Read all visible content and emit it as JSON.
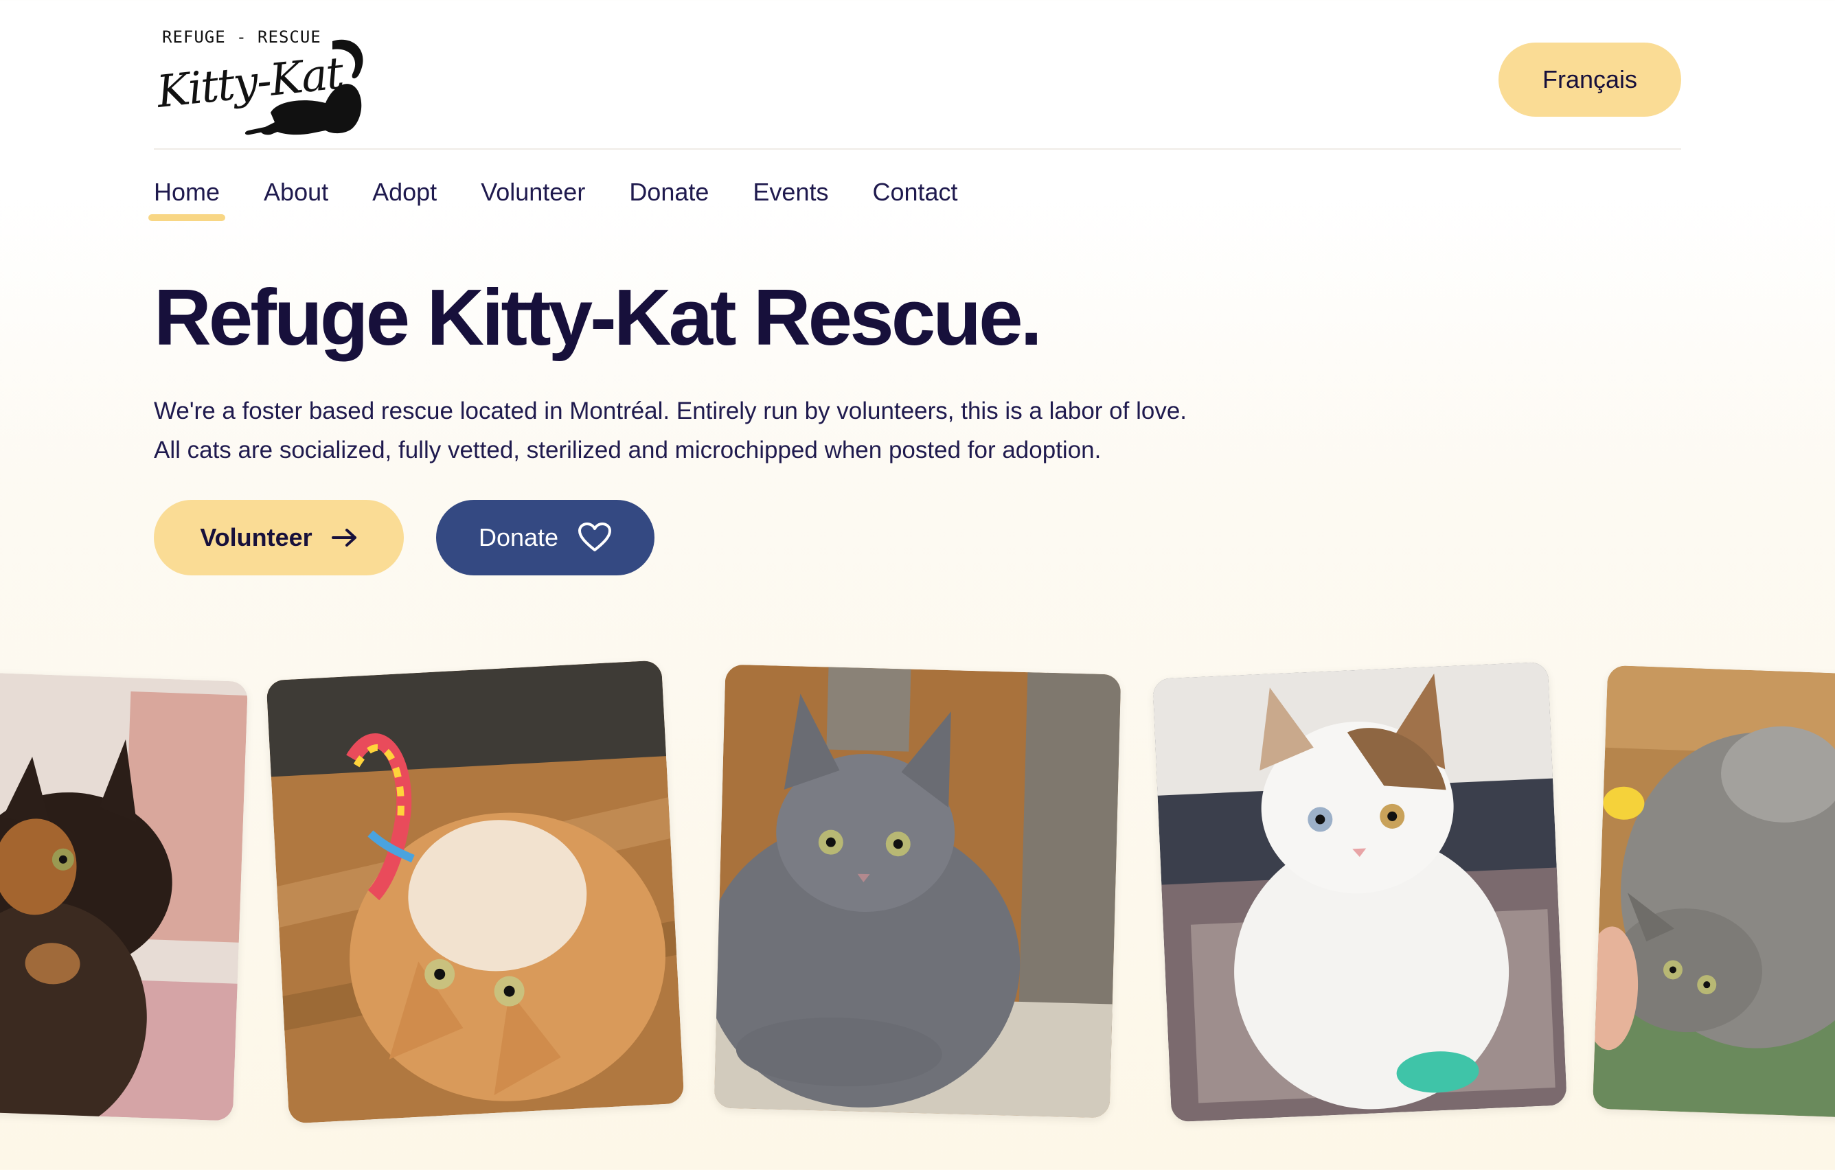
{
  "logo": {
    "top_text": "REFUGE - RESCUE",
    "script_text": "Kitty-Kat"
  },
  "header": {
    "language_button": "Français"
  },
  "nav": {
    "items": [
      {
        "label": "Home",
        "active": true
      },
      {
        "label": "About"
      },
      {
        "label": "Adopt"
      },
      {
        "label": "Volunteer"
      },
      {
        "label": "Donate"
      },
      {
        "label": "Events"
      },
      {
        "label": "Contact"
      }
    ]
  },
  "hero": {
    "title": "Refuge Kitty-Kat Rescue.",
    "line1": "We're a foster based rescue located in Montréal. Entirely run by volunteers, this is a labor of love.",
    "line2": "All cats are socialized, fully vetted, sterilized and microchipped when posted for adoption.",
    "volunteer_button": "Volunteer",
    "donate_button": "Donate"
  },
  "icons": {
    "volunteer_button": "arrow-right-icon",
    "donate_button": "heart-icon"
  },
  "colors": {
    "accent_yellow": "#fadc95",
    "donate_blue": "#344982",
    "heading": "#17103b",
    "nav_underline": "#f8d684"
  }
}
